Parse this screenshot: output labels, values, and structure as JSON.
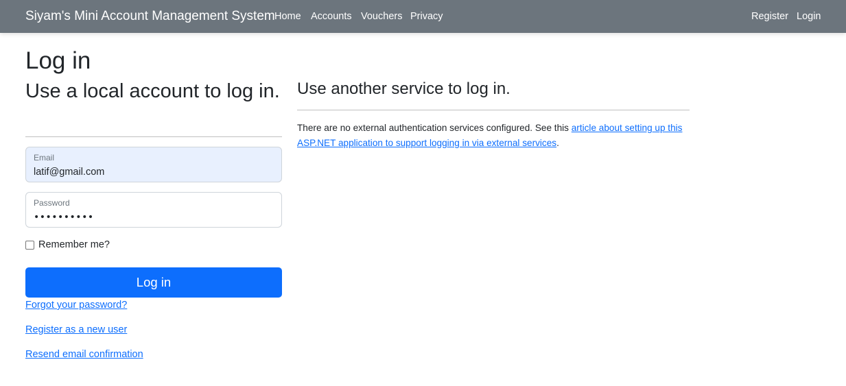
{
  "navbar": {
    "brand": "Siyam's Mini Account Management System",
    "links": [
      "Home",
      "Accounts",
      "Vouchers",
      "Privacy"
    ],
    "register": "Register",
    "login": "Login"
  },
  "page": {
    "title": "Log in"
  },
  "local": {
    "heading": "Use a local account to log in.",
    "email_label": "Email",
    "email_value": "latif@gmail.com",
    "password_label": "Password",
    "password_value": "••••••••••",
    "remember_label": "Remember me?",
    "login_button": "Log in",
    "forgot_link": "Forgot your password?",
    "register_link": "Register as a new user",
    "resend_link": "Resend email confirmation"
  },
  "external": {
    "heading": "Use another service to log in.",
    "text_before": "There are no external authentication services configured. See this ",
    "link_text": "article about setting up this ASP.NET application to support logging in via external services",
    "text_after": "."
  },
  "colors": {
    "navbar_bg": "#6c757d",
    "primary": "#0d6efd",
    "autofill_bg": "#e8f0fe"
  }
}
